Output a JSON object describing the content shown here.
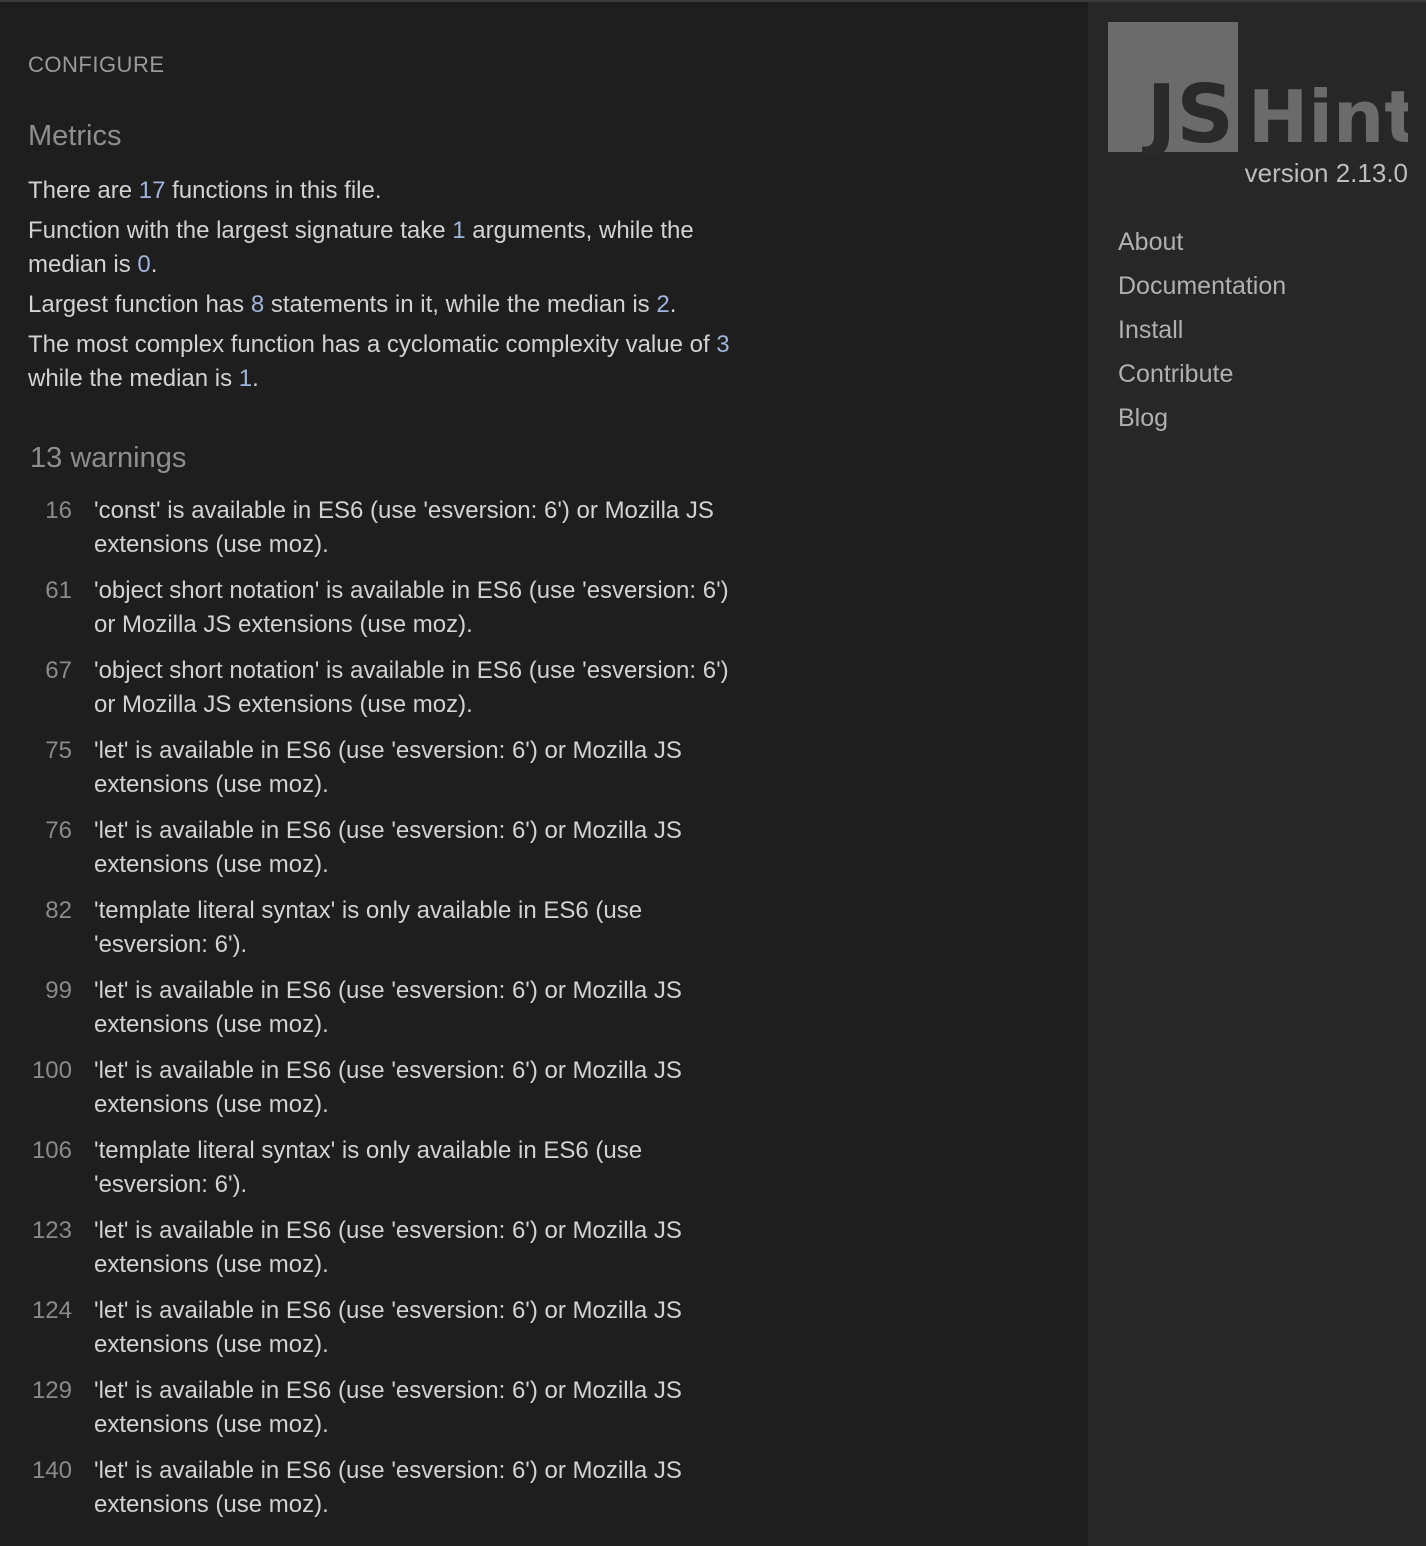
{
  "configure": {
    "label": "CONFIGURE"
  },
  "metrics": {
    "title": "Metrics",
    "functions_count": "17",
    "largest_signature": "1",
    "signature_median": "0",
    "largest_statements": "8",
    "statements_median": "2",
    "max_complexity": "3",
    "complexity_median": "1",
    "text": {
      "s1_pre": "There are ",
      "s1_post": " functions in this file.",
      "s2_pre": "Function with the largest signature take ",
      "s2_mid": " arguments, while the median is ",
      "s2_post": ".",
      "s3_pre": "Largest function has ",
      "s3_mid": " statements in it, while the median is ",
      "s3_post": ".",
      "s4_pre": "The most complex function has a cyclomatic complexity value of ",
      "s4_mid": " while the median is ",
      "s4_post": "."
    }
  },
  "warnings": {
    "title": "13 warnings",
    "items": [
      {
        "line": "16",
        "text": "'const' is available in ES6 (use 'esversion: 6') or Mozilla JS extensions (use moz)."
      },
      {
        "line": "61",
        "text": "'object short notation' is available in ES6 (use 'esversion: 6') or Mozilla JS extensions (use moz)."
      },
      {
        "line": "67",
        "text": "'object short notation' is available in ES6 (use 'esversion: 6') or Mozilla JS extensions (use moz)."
      },
      {
        "line": "75",
        "text": "'let' is available in ES6 (use 'esversion: 6') or Mozilla JS extensions (use moz)."
      },
      {
        "line": "76",
        "text": "'let' is available in ES6 (use 'esversion: 6') or Mozilla JS extensions (use moz)."
      },
      {
        "line": "82",
        "text": "'template literal syntax' is only available in ES6 (use 'esversion: 6')."
      },
      {
        "line": "99",
        "text": "'let' is available in ES6 (use 'esversion: 6') or Mozilla JS extensions (use moz)."
      },
      {
        "line": "100",
        "text": "'let' is available in ES6 (use 'esversion: 6') or Mozilla JS extensions (use moz)."
      },
      {
        "line": "106",
        "text": "'template literal syntax' is only available in ES6 (use 'esversion: 6')."
      },
      {
        "line": "123",
        "text": "'let' is available in ES6 (use 'esversion: 6') or Mozilla JS extensions (use moz)."
      },
      {
        "line": "124",
        "text": "'let' is available in ES6 (use 'esversion: 6') or Mozilla JS extensions (use moz)."
      },
      {
        "line": "129",
        "text": "'let' is available in ES6 (use 'esversion: 6') or Mozilla JS extensions (use moz)."
      },
      {
        "line": "140",
        "text": "'let' is available in ES6 (use 'esversion: 6') or Mozilla JS extensions (use moz)."
      }
    ]
  },
  "sidebar": {
    "logo_js": "JS",
    "logo_hint": "Hint",
    "version": "version 2.13.0",
    "nav": [
      "About",
      "Documentation",
      "Install",
      "Contribute",
      "Blog"
    ]
  },
  "colors": {
    "background": "#1e1e1e",
    "sidebar": "#272727",
    "number_accent": "#9fb4dc",
    "logo_box": "#6b6b6b"
  }
}
